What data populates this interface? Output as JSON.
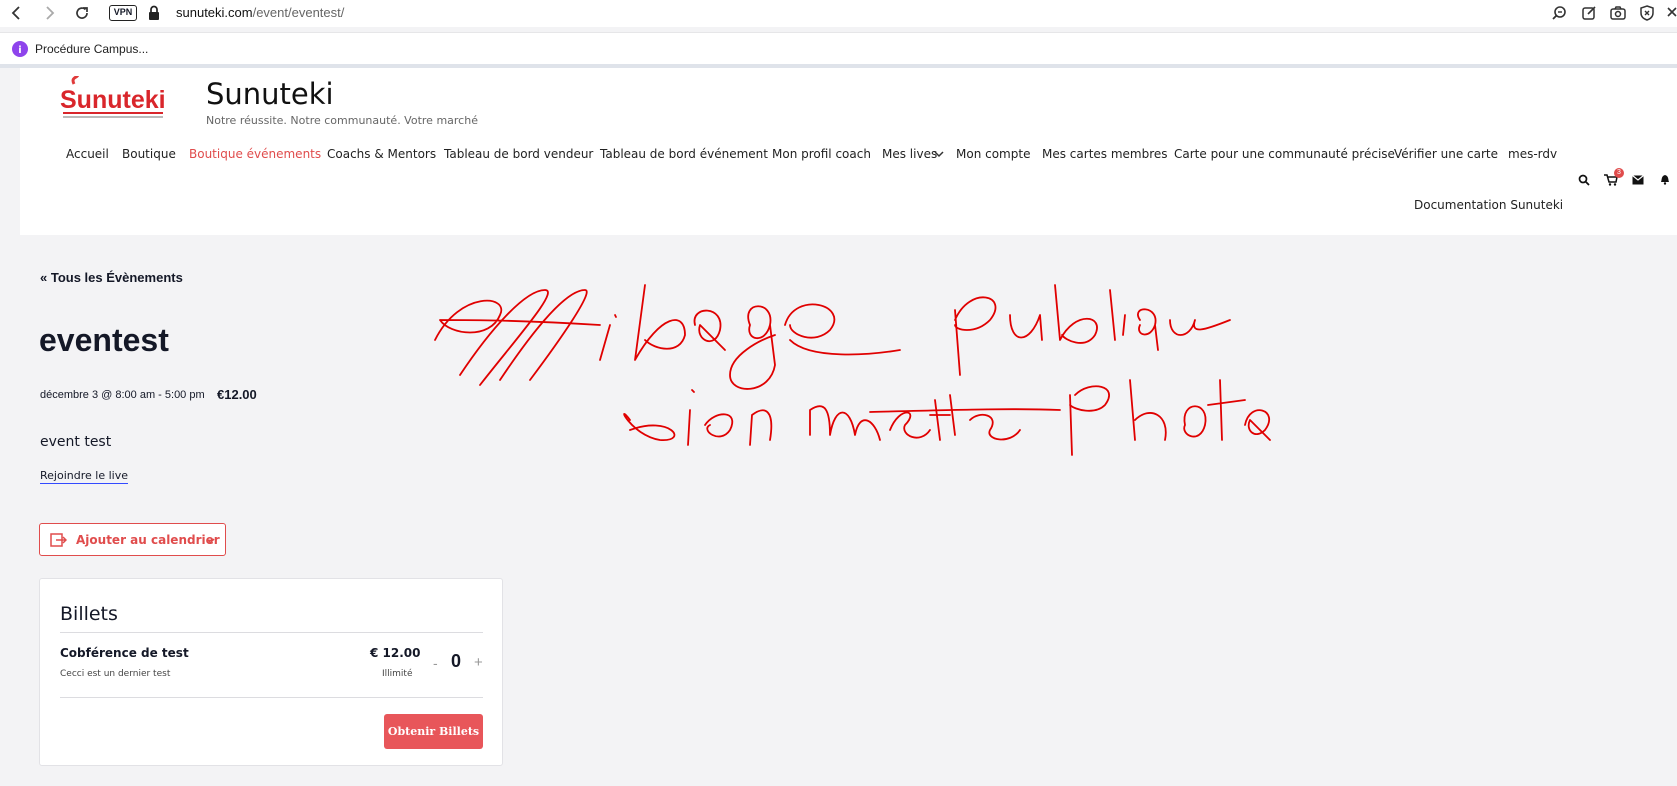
{
  "browser": {
    "vpn_label": "VPN",
    "url_domain": "sunuteki.com",
    "url_path": "/event/eventest/",
    "bookmark_label": "Procédure Campus..."
  },
  "site": {
    "logo_text": "Sunuteki",
    "title": "Sunuteki",
    "tagline": "Notre réussite. Notre communauté. Votre marché",
    "cart_count": "3"
  },
  "nav": {
    "items": [
      {
        "label": "Accueil"
      },
      {
        "label": "Boutique"
      },
      {
        "label": "Boutique événements"
      },
      {
        "label": "Coachs & Mentors"
      },
      {
        "label": "Tableau de bord vendeur"
      },
      {
        "label": "Tableau de bord événement"
      },
      {
        "label": "Mon profil coach"
      },
      {
        "label": "Mes lives"
      },
      {
        "label": "Mon compte"
      },
      {
        "label": "Mes cartes membres"
      },
      {
        "label": "Carte pour une communauté précise"
      },
      {
        "label": "Vérifier une carte"
      },
      {
        "label": "mes-rdv"
      },
      {
        "label": "Documentation Sunuteki"
      }
    ]
  },
  "event": {
    "back_link": "« Tous les Évènements",
    "title": "eventest",
    "date": "décembre 3 @ 8:00 am - 5:00 pm",
    "price": "€12.00",
    "description": "event test",
    "join_live": "Rejoindre le live",
    "calendar_button": "Ajouter au calendrier"
  },
  "tickets": {
    "heading": "Billets",
    "items": [
      {
        "name": "Cobférence de test",
        "description": "Cecci est un dernier test",
        "price": "€ 12.00",
        "availability": "Illimité",
        "quantity": "0",
        "minus": "-",
        "plus": "+"
      }
    ],
    "submit_label": "Obtenir Billets"
  },
  "colors": {
    "accent": "#e04c4c",
    "button": "#e8565a",
    "page_background": "#f3f3f5",
    "annotation": "#e00000"
  }
}
